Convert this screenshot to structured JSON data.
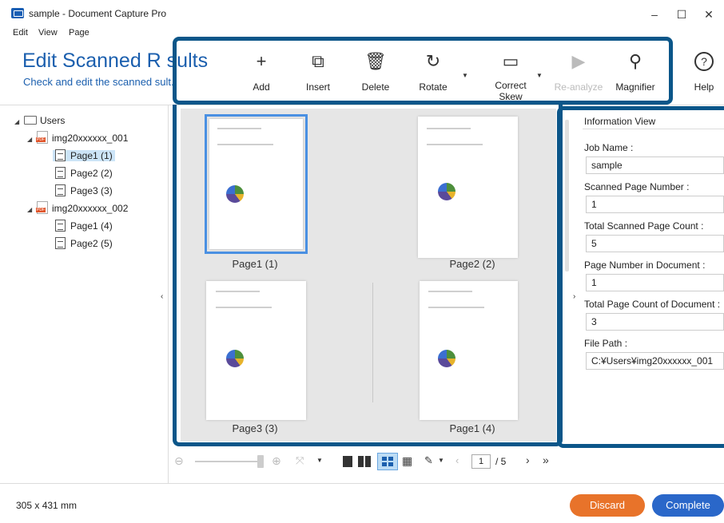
{
  "window": {
    "title": "sample - Document Capture Pro",
    "minimize": "–",
    "maximize": "☐",
    "close": "✕"
  },
  "menu": [
    "Edit",
    "View",
    "Page"
  ],
  "header": {
    "title": "Edit Scanned R   sults",
    "subtitle": "Check and edit the scanned   sult."
  },
  "toolbar": [
    {
      "label": "Add",
      "icon": "plus-icon",
      "glyph": "+"
    },
    {
      "label": "Insert",
      "icon": "insert-icon",
      "glyph": "⧉"
    },
    {
      "label": "Delete",
      "icon": "trash-icon",
      "glyph": "🗑"
    },
    {
      "label": "Rotate",
      "icon": "rotate-icon",
      "glyph": "↻"
    },
    {
      "label": "Correct Skew",
      "icon": "skew-icon",
      "glyph": "▭"
    },
    {
      "label": "Re-analyze",
      "icon": "play-icon",
      "glyph": "▶"
    },
    {
      "label": "Magnifier",
      "icon": "search-icon",
      "glyph": "⚲"
    },
    {
      "label": "Help",
      "icon": "help-icon",
      "glyph": "?"
    }
  ],
  "tree": {
    "root": "Users",
    "docs": [
      {
        "name": "img20xxxxxx_001",
        "pages": [
          "Page1 (1)",
          "Page2 (2)",
          "Page3 (3)"
        ]
      },
      {
        "name": "img20xxxxxx_002",
        "pages": [
          "Page1 (4)",
          "Page2 (5)"
        ]
      }
    ]
  },
  "thumbnails": [
    "Page1 (1)",
    "Page2 (2)",
    "Page3 (3)",
    "Page1 (4)"
  ],
  "pager": {
    "current": "1",
    "total": "/ 5"
  },
  "info": {
    "heading": "Information View",
    "fields": [
      {
        "label": "Job Name :",
        "value": "sample"
      },
      {
        "label": "Scanned Page Number :",
        "value": "1"
      },
      {
        "label": "Total Scanned Page Count :",
        "value": "5"
      },
      {
        "label": "Page Number in Document :",
        "value": "1"
      },
      {
        "label": "Total Page Count of Document :",
        "value": "3"
      },
      {
        "label": "File Path :",
        "value": "C:¥Users¥img20xxxxxx_001"
      }
    ]
  },
  "status": {
    "size": "305 x 431 mm"
  },
  "buttons": {
    "discard": "Discard",
    "complete": "Complete"
  },
  "colors": {
    "accent": "#1b5fae",
    "highlight": "#0b5689",
    "discard": "#e8732a",
    "complete": "#2a67c9"
  }
}
